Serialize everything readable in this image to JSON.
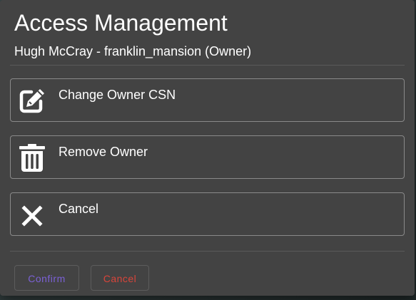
{
  "dialog": {
    "title": "Access Management",
    "subtitle": "Hugh McCray - franklin_mansion (Owner)"
  },
  "options": [
    {
      "label": "Change Owner CSN",
      "icon": "edit-icon"
    },
    {
      "label": "Remove Owner",
      "icon": "trash-icon"
    },
    {
      "label": "Cancel",
      "icon": "close-icon"
    }
  ],
  "actions": {
    "confirm_label": "Confirm",
    "cancel_label": "Cancel"
  },
  "colors": {
    "dialog_bg": "#434343",
    "confirm_text": "#7b61d6",
    "cancel_text": "#d9443a",
    "option_border": "#8a8a8a"
  }
}
